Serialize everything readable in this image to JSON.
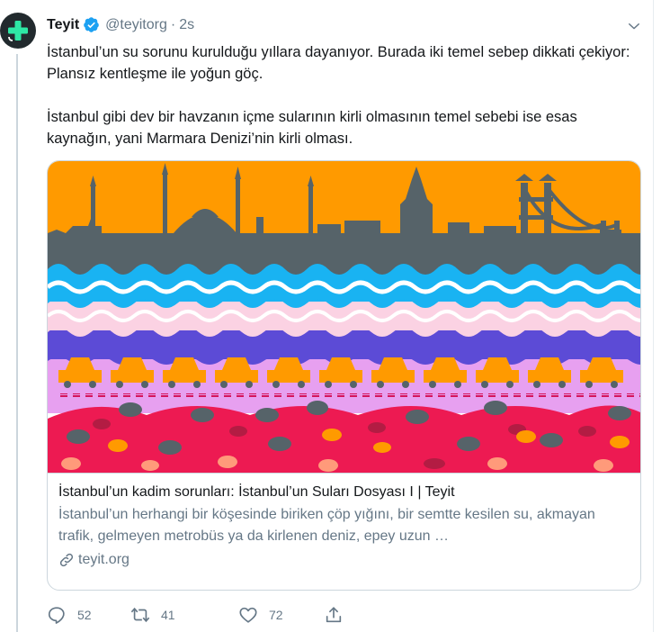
{
  "tweet": {
    "author_name": "Teyit",
    "handle": "@teyitorg",
    "separator": "·",
    "time": "2s",
    "paragraphs": [
      "İstanbul’un su sorunu kurulduğu yıllara dayanıyor. Burada iki temel sebep dikkati çekiyor: Plansız kentleşme ile yoğun göç.",
      "İstanbul gibi dev bir havzanın içme sularının kirli olmasının temel sebebi ise esas kaynağın, yani Marmara Denizi’nin kirli olması."
    ]
  },
  "card": {
    "title": "İstanbul’un kadim sorunları: İstanbul’un Suları Dosyası I | Teyit",
    "description": "İstanbul’un herhangi bir köşesinde biriken çöp yığını, bir semtte kesilen su, akmayan trafik, gelmeyen metrobüs ya da kirlenen deniz, epey uzun …",
    "domain": "teyit.org"
  },
  "actions": {
    "reply_count": "52",
    "retweet_count": "41",
    "like_count": "72"
  },
  "colors": {
    "accent": "#1da1f2",
    "muted": "#657786",
    "avatar_bg": "#222a2e",
    "avatar_cross": "#2ee8a5",
    "illustration_sky": "#ff9a00",
    "illustration_skyline": "#566369",
    "illustration_sea_blue": "#19b3f2",
    "illustration_pink": "#fbd2e3",
    "illustration_purple": "#5c4bd6",
    "illustration_lilac": "#e7a0f0",
    "illustration_car": "#ff9a00",
    "illustration_red": "#ed1a52"
  },
  "icons": [
    "teyit-logo-icon",
    "verified-badge-icon",
    "chevron-down-icon",
    "link-icon",
    "reply-icon",
    "retweet-icon",
    "like-icon",
    "share-icon"
  ]
}
